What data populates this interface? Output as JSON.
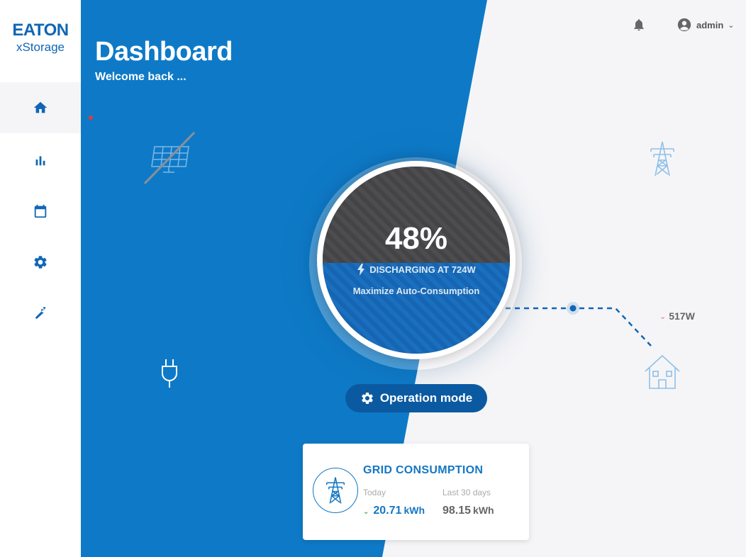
{
  "brand": {
    "logo_main": "EATON",
    "logo_sub": "xStorage",
    "color": "#1066b4"
  },
  "sidebar": {
    "items": [
      {
        "icon": "home-icon",
        "active": true
      },
      {
        "icon": "bar-chart-icon",
        "active": false
      },
      {
        "icon": "calendar-icon",
        "active": false
      },
      {
        "icon": "gear-icon",
        "active": false
      },
      {
        "icon": "wrench-icon",
        "active": false
      }
    ]
  },
  "header": {
    "title": "Dashboard",
    "subtitle": "Welcome back ...",
    "user_name": "admin",
    "notification_icon": "bell-icon"
  },
  "battery": {
    "percent_label": "48%",
    "level": 0.48,
    "status": "DISCHARGING AT 724W",
    "mode": "Maximize Auto-Consumption"
  },
  "flow": {
    "house_power": "517W",
    "house_direction": "down"
  },
  "operation_button": {
    "label": "Operation mode",
    "icon": "gear-icon"
  },
  "grid_card": {
    "title": "GRID CONSUMPTION",
    "today_label": "Today",
    "today_value": "20.71",
    "today_unit": "kWh",
    "month_label": "Last 30 days",
    "month_value": "98.15",
    "month_unit": "kWh"
  },
  "colors": {
    "accent_blue": "#0e7ac7",
    "dark_button": "#0b5aa1",
    "grid_blue": "#1577c2"
  }
}
